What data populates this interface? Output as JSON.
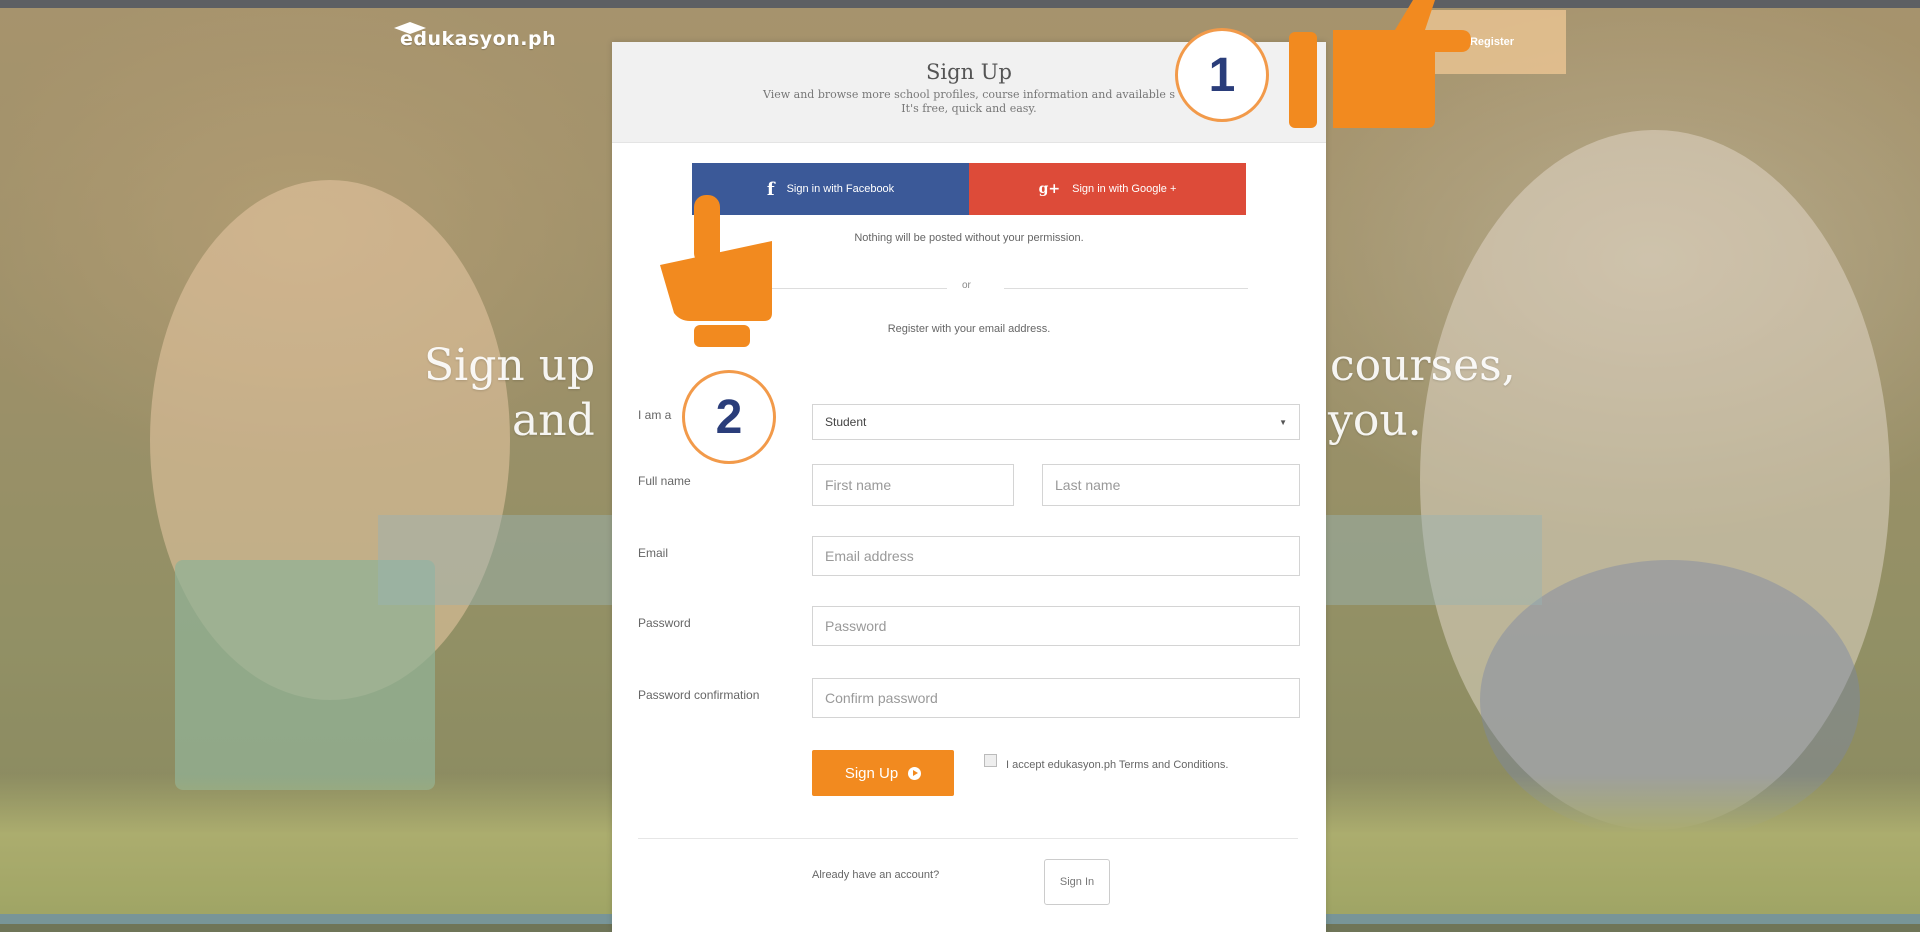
{
  "brand": {
    "logo": "edukasyon.ph"
  },
  "header": {
    "register_label": "Register"
  },
  "hero": {
    "line1_left": "Sign up",
    "line1_right": "courses,",
    "line2_left": "and",
    "line2_right": "you."
  },
  "modal": {
    "title": "Sign Up",
    "subtitle_line1": "View and browse more school profiles, course information and available s",
    "subtitle_line2": "It's free, quick and easy.",
    "facebook_label": "Sign in with Facebook",
    "google_label": "Sign in with Google +",
    "permission_note": "Nothing will be posted without your permission.",
    "or_text": "or",
    "register_note": "Register with your email address.",
    "labels": {
      "role": "I am a",
      "full_name": "Full name",
      "email": "Email",
      "password": "Password",
      "password_confirmation": "Password confirmation"
    },
    "role_value": "Student",
    "placeholders": {
      "first_name": "First name",
      "last_name": "Last name",
      "email": "Email address",
      "password": "Password",
      "confirm_password": "Confirm password"
    },
    "signup_label": "Sign Up",
    "terms_text": "I accept edukasyon.ph Terms and Conditions.",
    "already_text": "Already have an account?",
    "signin_label": "Sign In"
  },
  "annotations": {
    "step1": "1",
    "step2": "2"
  },
  "colors": {
    "accent": "#f28a1f",
    "facebook": "#3b5998",
    "google": "#dd4b39",
    "step_text": "#2a3d7a"
  }
}
